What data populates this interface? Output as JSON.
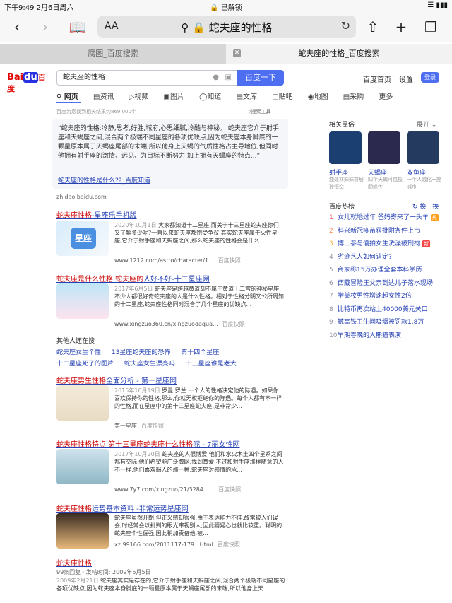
{
  "status": {
    "time": "下午9:49",
    "date": "2月6日周六",
    "lock": "已解锁"
  },
  "toolbar": {
    "aa": "AA",
    "site": "蛇夫座的性格"
  },
  "tabs": [
    {
      "label": "腐图_百度搜索"
    },
    {
      "label": "蛇夫座的性格_百度搜索"
    }
  ],
  "header": {
    "logo_bai": "Bai",
    "logo_du": "du",
    "logo_cn": "百度",
    "query": "蛇夫座的性格",
    "search_btn": "百度一下",
    "home": "百度首页",
    "settings": "设置",
    "login": "登录"
  },
  "nav": [
    "网页",
    "资讯",
    "视频",
    "图片",
    "知道",
    "文库",
    "贴吧",
    "地图",
    "采购",
    "更多"
  ],
  "stats": "百度为您找到相关结果约869,000个",
  "tools": "搜索工具",
  "snippet": {
    "text": "“蛇夫座的性格:冷静,思考,好胜,城府,心思细腻,冷酷与神秘。 蛇夫座它介于射手座和天蝎座之间,混合两个极端不同星座的各项优缺点,因为蛇夫座本身脚底的一颗星原本属于天蝎座尾部的末端,所以他身上天蝎的气质性格占主导地位,但同时他拥有射手座的激情、远见、为目标不断努力,加上拥有天蝎座的特点...”",
    "title": "蛇夫座的性格是什么??_百度知道",
    "source": "zhidao.baidu.com"
  },
  "results": [
    {
      "title_a": "蛇夫座性格",
      "title_b": "-星座乐手机版",
      "date": "2020年10月1日",
      "body": " 大家都知道十二星座,而关于十三星座蛇夫座你们又了解多少呢?一直以来蛇夫座都饱受争议,其实蛇夫座属于火性星座,它介于射手座和天蝎座之间,那么蛇夫座的性格会是什么...",
      "url": "www.1212.com/astro/character/1...",
      "snap": "百度快照",
      "thumb_text": "星座"
    },
    {
      "title_a": "蛇夫座是什么性格 蛇夫座的",
      "title_b": "人好不好-十二星座网",
      "date": "2017年6月5日",
      "body": " 蛇夫座是跨越黄道却不属于黄道十二宫的神秘星座,不少人都很好奇蛇夫座的人是什么性格。相对于性格分明又公所周知的十二星座,蛇夫座性格同时混合了几个星座的优缺点...",
      "url": "www.xingzuo360.cn/xingzuodaqua...",
      "snap": "百度快照"
    },
    {
      "title_a": "蛇夫座男生性格",
      "title_b": "全面分析 - 第一星座网",
      "date": "2015年10月19日",
      "body": " 罗曼·罗兰:一个人的性格决定他的际遇。如果你喜欢保持你的性格,那么,你就无权拒绝你的际遇。每个人都有不一样的性格,而在星座中的第十三星座蛇夫座,是非常少...",
      "url": "第一星座",
      "snap": "百度快照"
    },
    {
      "title_a": "蛇夫座性格特点 第十三星座蛇夫座什么性格",
      "title_b": "呢 - 7丽女性网",
      "date": "2017年10月20日",
      "body": " 蛇夫座的人很博爱,他们和水火木土四个星系之间都有交际,他们希望能广泛撒网,找到真爱,不过和射手座那样随意的人不一样,他们喜欢黏人的那一种,蛇夫座对感情的承...",
      "url": "www.7y7.com/xingzuo/21/3284......",
      "snap": "百度快照"
    },
    {
      "title_a": "蛇夫座性格",
      "title_b": "运势基本资料 -非常运势星座网",
      "date": "",
      "body": "蛇夫座虽然开朗,但正义感却很强,由于表达能力不佳,故常被人们误会,时经常会以批判的眼光审视别人,因此猜疑心也就比较重。聪明的蛇夫座个性倔强,因此稍加责备他,被...",
      "url": "xz.99166.com/2011117-179...Html",
      "snap": "百度快照"
    }
  ],
  "others": {
    "heading": "其他人还在搜",
    "row1": [
      "蛇夫座女生个性",
      "13星座蛇夫座的恐怖",
      "第十四个星座"
    ],
    "row2": [
      "十二星座死了的图片",
      "蛇夫座女生漂亮吗",
      "十三星座谁是老大"
    ]
  },
  "last": {
    "title": "蛇夫座性格",
    "meta": "99条回复 · 发帖时间: 2009年5月5日",
    "date": "2009年2月21日",
    "body": " 蛇夫座其实是存在的,它介于射手座和天蝎座之间,混合两个极端不同星座的各项优缺点,因为蛇夫座本身脚底的一颗星原本属于天蝎座尾部的末端,所以他身上天..."
  },
  "related": {
    "heading": "相关民俗",
    "more": "展开",
    "items": [
      {
        "name": "射手座",
        "desc": "独处林妹妹群居孙悟空",
        "color": "#1c3f72"
      },
      {
        "name": "天蝎座",
        "desc": "四个天蝎可包揽翻蝶传",
        "color": "#2b2a4e"
      },
      {
        "name": "双鱼座",
        "desc": "一个人融化一座城市",
        "color": "#243a5e"
      }
    ]
  },
  "hot": {
    "heading": "百度热榜",
    "refresh": "换一换",
    "items": [
      {
        "n": "1",
        "text": "女儿就地过年 爸妈寄来了一头羊",
        "badge": "热",
        "badge_color": "#ff9f1c"
      },
      {
        "n": "2",
        "text": "科兴新冠疫苗获批附条件上市",
        "badge": ""
      },
      {
        "n": "3",
        "text": "博士参与偷拍女生洗澡被刑拘",
        "badge": "新",
        "badge_color": "#f54545"
      },
      {
        "n": "4",
        "text": "劣迹艺人如何认定?",
        "badge": ""
      },
      {
        "n": "5",
        "text": "商家称15万办理全套本科学历",
        "badge": ""
      },
      {
        "n": "6",
        "text": "西藏冒险王父亲到达儿子落水现场",
        "badge": ""
      },
      {
        "n": "7",
        "text": "学美妆男性增速超女性2倍",
        "badge": ""
      },
      {
        "n": "8",
        "text": "比特币再次站上40000美元关口",
        "badge": ""
      },
      {
        "n": "9",
        "text": "鲸高铁卫生间吸烟被罚款1.8万",
        "badge": ""
      },
      {
        "n": "10",
        "text": "早期春晚的大熊猫表演",
        "badge": ""
      }
    ]
  }
}
